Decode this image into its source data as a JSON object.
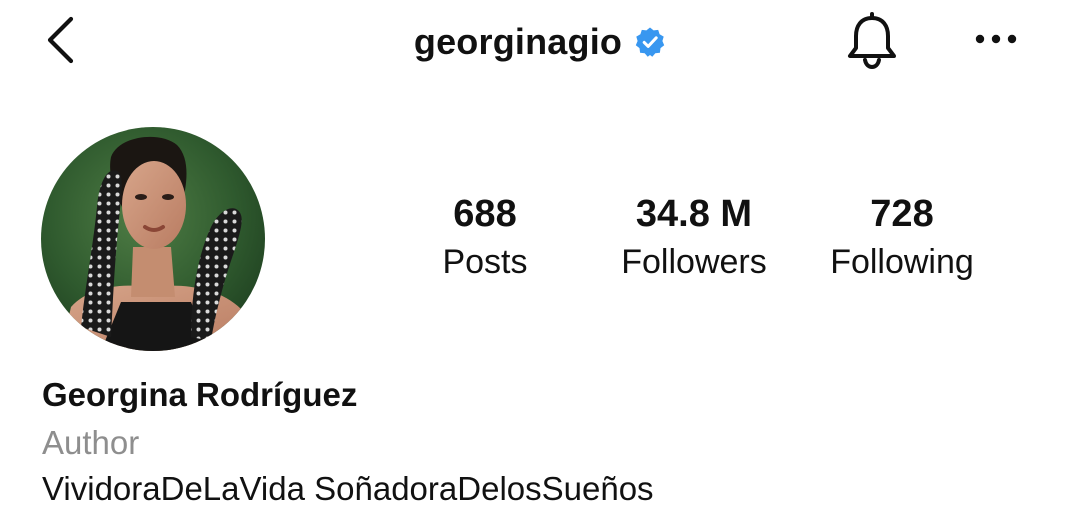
{
  "nav": {
    "username": "georginagio",
    "verified": true,
    "icons": {
      "back": "chevron-left-icon",
      "verified": "verified-badge-icon",
      "notifications": "bell-icon",
      "more": "more-horizontal-icon"
    }
  },
  "profile": {
    "stats": [
      {
        "value": "688",
        "label": "Posts"
      },
      {
        "value": "34.8 M",
        "label": "Followers"
      },
      {
        "value": "728",
        "label": "Following"
      }
    ],
    "display_name": "Georgina Rodríguez",
    "category": "Author",
    "bio": "VividoraDeLaVida SoñadoraDelosSueños"
  },
  "colors": {
    "text": "#111111",
    "muted": "#8e8e8e",
    "verified": "#3897f0",
    "background": "#ffffff"
  }
}
